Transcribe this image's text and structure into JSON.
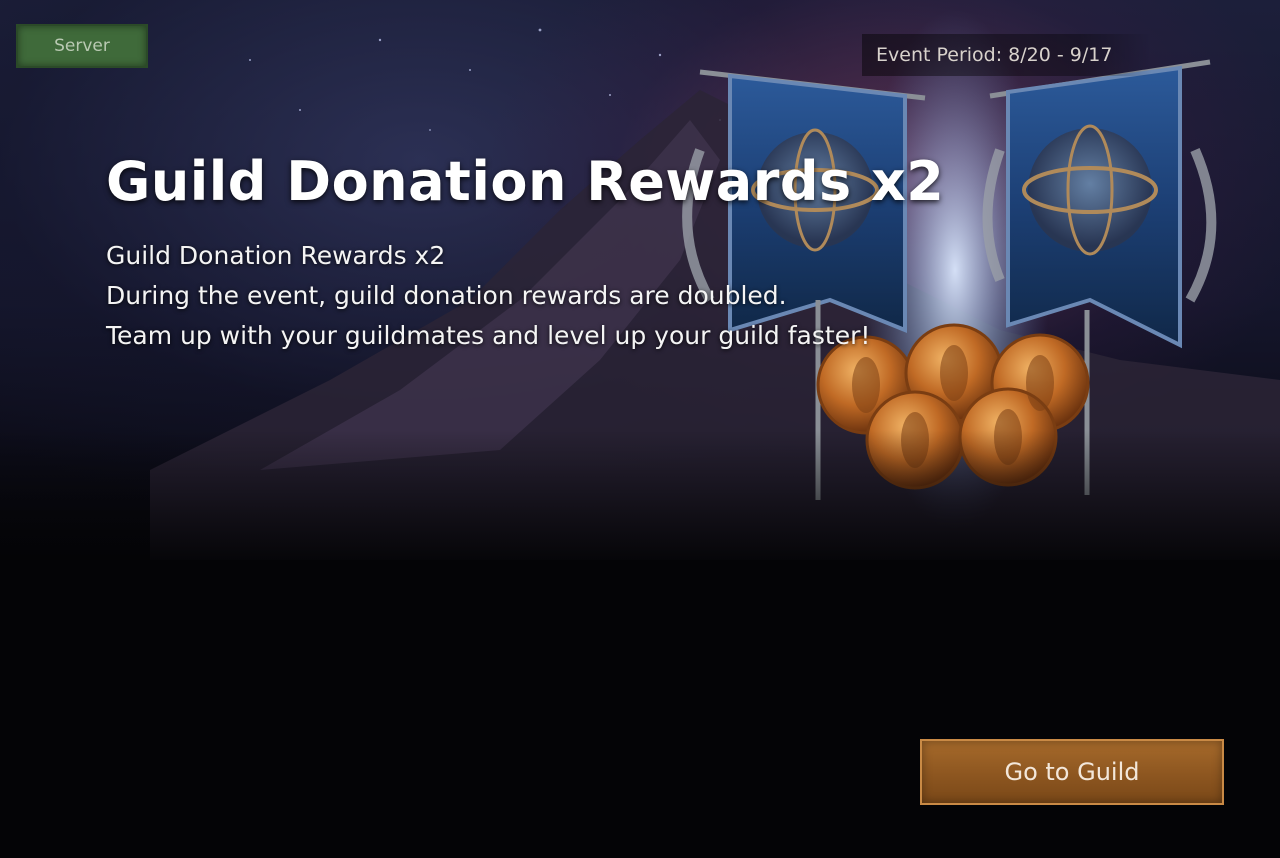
{
  "server_button": {
    "label": "Server"
  },
  "event_period": {
    "text": "Event Period: 8/20 - 9/17"
  },
  "event": {
    "title": "Guild Donation Rewards x2",
    "lines": [
      "Guild Donation Rewards x2",
      "During the event, guild donation rewards are doubled.",
      "Team up with your guildmates and level up your guild faster!"
    ]
  },
  "go_button": {
    "label": "Go to Guild"
  },
  "colors": {
    "accent_button": "#9a6126",
    "server_button": "#3f6a3a",
    "text": "#ffffff"
  },
  "icons": {
    "banners": "guild-banner-icon",
    "coins": "guild-coin-icon",
    "laurel": "laurel-wreath-icon"
  }
}
